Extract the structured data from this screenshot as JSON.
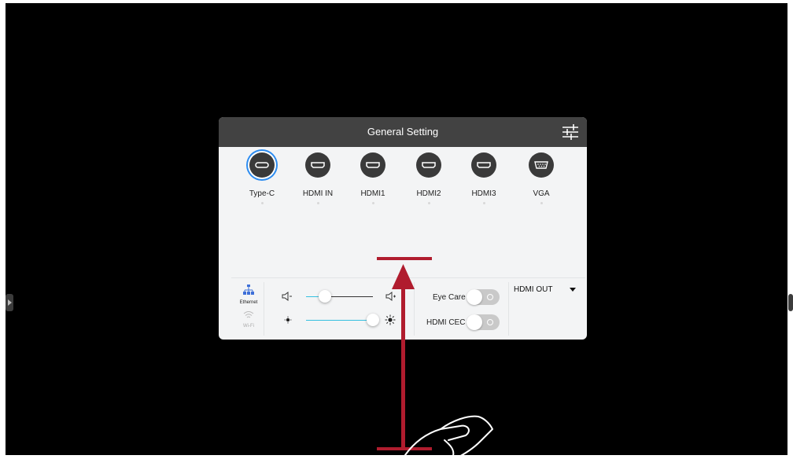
{
  "panel": {
    "title": "General Setting",
    "settings_icon": "sliders-icon"
  },
  "sources": [
    {
      "label": "Type-C",
      "icon": "usb-c-icon",
      "active": true
    },
    {
      "label": "HDMI IN",
      "icon": "hdmi-icon",
      "active": false
    },
    {
      "label": "HDMI1",
      "icon": "hdmi-icon",
      "active": false
    },
    {
      "label": "HDMI2",
      "icon": "hdmi-icon",
      "active": false
    },
    {
      "label": "HDMI3",
      "icon": "hdmi-icon",
      "active": false
    },
    {
      "label": "VGA",
      "icon": "vga-icon",
      "active": false
    }
  ],
  "network": {
    "ethernet_label": "Ethernet",
    "wifi_label": "Wi-Fi"
  },
  "sliders": {
    "volume": {
      "value": 0.28,
      "icon_low": "volume-low-icon",
      "icon_high": "volume-high-icon"
    },
    "brightness": {
      "value": 1.0,
      "icon_low": "brightness-low-icon",
      "icon_high": "brightness-high-icon"
    }
  },
  "toggles": {
    "eye_care": {
      "label": "Eye Care",
      "on": false
    },
    "hdmi_cec": {
      "label": "HDMI CEC",
      "on": false
    }
  },
  "hdmi_out": {
    "label": "HDMI OUT"
  },
  "colors": {
    "accent": "#2d8cf0",
    "slider_fill": "#35c0e0",
    "gesture_arrow": "#b01c2e"
  }
}
